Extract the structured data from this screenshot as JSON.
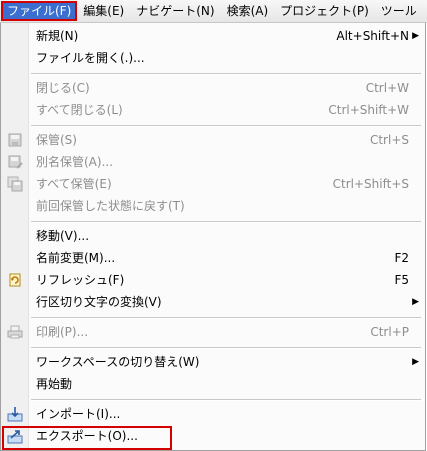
{
  "menubar": {
    "items": [
      "ファイル(F)",
      "編集(E)",
      "ナビゲート(N)",
      "検索(A)",
      "プロジェクト(P)",
      "ツール"
    ]
  },
  "menu": {
    "items": [
      {
        "label": "新規(N)",
        "shortcut": "Alt+Shift+N",
        "submenu": true,
        "enabled": true
      },
      {
        "label": "ファイルを開く(.)...",
        "shortcut": "",
        "enabled": true
      },
      {
        "label": "閉じる(C)",
        "shortcut": "Ctrl+W",
        "enabled": false
      },
      {
        "label": "すべて閉じる(L)",
        "shortcut": "Ctrl+Shift+W",
        "enabled": false
      },
      {
        "label": "保管(S)",
        "shortcut": "Ctrl+S",
        "enabled": false,
        "icon": "save-icon"
      },
      {
        "label": "別名保管(A)...",
        "shortcut": "",
        "enabled": false,
        "icon": "save-as-icon"
      },
      {
        "label": "すべて保管(E)",
        "shortcut": "Ctrl+Shift+S",
        "enabled": false,
        "icon": "save-all-icon"
      },
      {
        "label": "前回保管した状態に戻す(T)",
        "shortcut": "",
        "enabled": false
      },
      {
        "label": "移動(V)...",
        "shortcut": "",
        "enabled": true
      },
      {
        "label": "名前変更(M)...",
        "shortcut": "F2",
        "enabled": true
      },
      {
        "label": "リフレッシュ(F)",
        "shortcut": "F5",
        "enabled": true,
        "icon": "refresh-icon"
      },
      {
        "label": "行区切り文字の変換(V)",
        "shortcut": "",
        "submenu": true,
        "enabled": true
      },
      {
        "label": "印刷(P)...",
        "shortcut": "Ctrl+P",
        "enabled": false,
        "icon": "print-icon"
      },
      {
        "label": "ワークスペースの切り替え(W)",
        "shortcut": "",
        "submenu": true,
        "enabled": true
      },
      {
        "label": "再始動",
        "shortcut": "",
        "enabled": true
      },
      {
        "label": "インポート(I)...",
        "shortcut": "",
        "enabled": true,
        "icon": "import-icon"
      },
      {
        "label": "エクスポート(O)...",
        "shortcut": "",
        "enabled": true,
        "icon": "export-icon"
      }
    ]
  }
}
